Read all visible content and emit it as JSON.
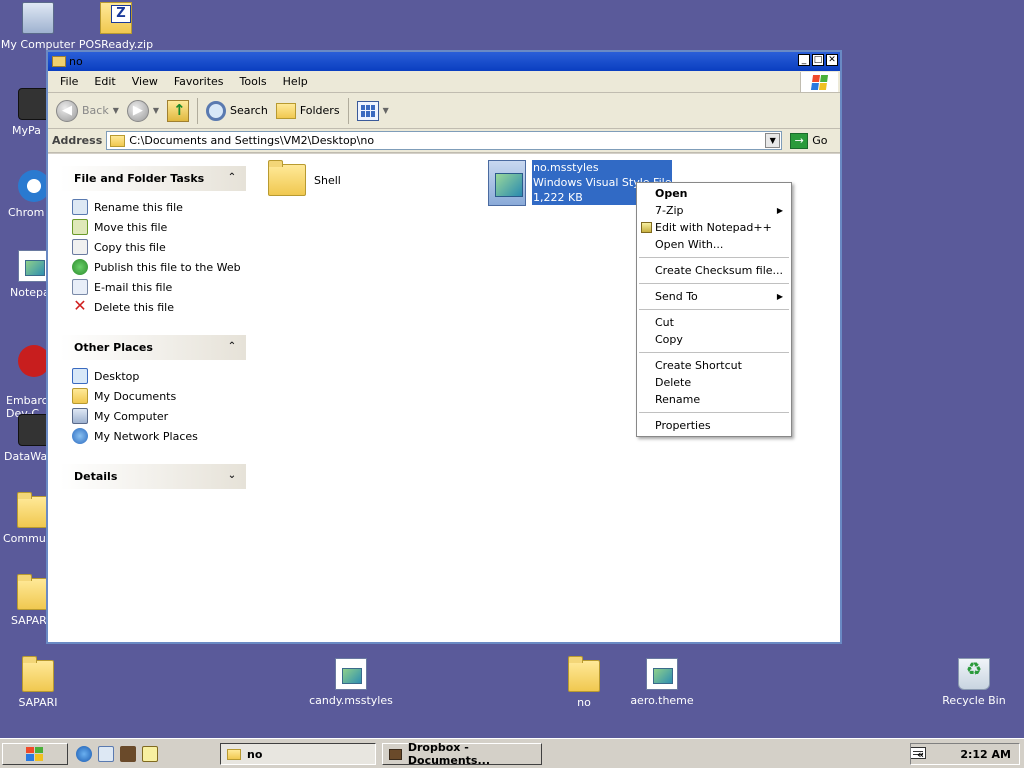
{
  "desktop": {
    "icons": [
      {
        "label": "My Computer"
      },
      {
        "label": "POSReady.zip"
      },
      {
        "label": "MyPa"
      },
      {
        "label": "Chrom"
      },
      {
        "label": "Notepa"
      },
      {
        "label": "Embarca\nDev-C"
      },
      {
        "label": "DataWa"
      },
      {
        "label": "Commun"
      },
      {
        "label": "SAPAR"
      },
      {
        "label": "SAPARI"
      },
      {
        "label": "candy.msstyles"
      },
      {
        "label": "no"
      },
      {
        "label": "aero.theme"
      },
      {
        "label": "Recycle Bin"
      }
    ]
  },
  "window": {
    "title": "no",
    "menu": [
      "File",
      "Edit",
      "View",
      "Favorites",
      "Tools",
      "Help"
    ],
    "toolbar": {
      "back": "Back",
      "search": "Search",
      "folders": "Folders"
    },
    "address": {
      "label": "Address",
      "value": "C:\\Documents and Settings\\VM2\\Desktop\\no",
      "go": "Go"
    },
    "tasks": {
      "file_folder": {
        "title": "File and Folder Tasks",
        "items": [
          "Rename this file",
          "Move this file",
          "Copy this file",
          "Publish this file to the Web",
          "E-mail this file",
          "Delete this file"
        ]
      },
      "other_places": {
        "title": "Other Places",
        "items": [
          "Desktop",
          "My Documents",
          "My Computer",
          "My Network Places"
        ]
      },
      "details": {
        "title": "Details"
      }
    },
    "files": {
      "folder_name": "Shell",
      "selected_file": {
        "name": "no.msstyles",
        "type": "Windows Visual Style File",
        "size": "1,222 KB"
      }
    }
  },
  "context_menu": {
    "items": [
      "Open",
      "7-Zip",
      "Edit with Notepad++",
      "Open With...",
      "Create Checksum file...",
      "Send To",
      "Cut",
      "Copy",
      "Create Shortcut",
      "Delete",
      "Rename",
      "Properties"
    ]
  },
  "taskbar": {
    "tasks": [
      "no",
      "Dropbox - Documents..."
    ],
    "tray_chevron": "«",
    "clock": "2:12 AM"
  },
  "colors": {
    "desktop": "#5a5a9a",
    "selection": "#316ac5",
    "titlebar": "#0a3ec0"
  }
}
